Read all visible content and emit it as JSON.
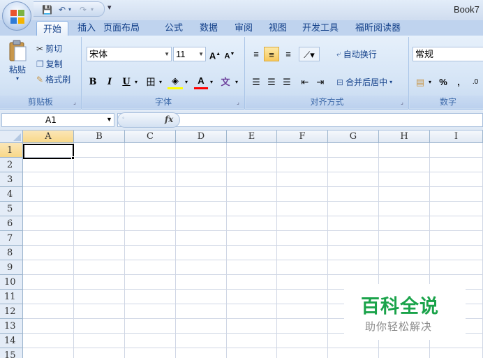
{
  "window": {
    "doc_title": "Book7"
  },
  "qat": {
    "save": "💾",
    "undo": "↶",
    "redo": "↷",
    "customize": "▾"
  },
  "tabs": [
    {
      "label": "开始"
    },
    {
      "label": "插入"
    },
    {
      "label": "页面布局"
    },
    {
      "label": "公式"
    },
    {
      "label": "数据"
    },
    {
      "label": "审阅"
    },
    {
      "label": "视图"
    },
    {
      "label": "开发工具"
    },
    {
      "label": "福昕阅读器"
    }
  ],
  "clipboard": {
    "paste": "粘贴",
    "cut": "剪切",
    "copy": "复制",
    "format_painter": "格式刷",
    "group_label": "剪贴板"
  },
  "font": {
    "name": "宋体",
    "size": "11",
    "grow": "A",
    "shrink": "A",
    "bold": "B",
    "italic": "I",
    "underline": "U",
    "border": "田",
    "fill": "◈",
    "color": "A",
    "phonetic": "文",
    "group_label": "字体"
  },
  "alignment": {
    "wrap": "自动换行",
    "merge": "合并后居中",
    "group_label": "对齐方式"
  },
  "number": {
    "format": "常规",
    "percent": "%",
    "comma": ",",
    "group_label": "数字"
  },
  "formula_bar": {
    "namebox": "A1",
    "fx": "fx"
  },
  "columns": [
    "A",
    "B",
    "C",
    "D",
    "E",
    "F",
    "G",
    "H",
    "I"
  ],
  "rows": [
    "1",
    "2",
    "3",
    "4",
    "5",
    "6",
    "7",
    "8",
    "9",
    "10",
    "11",
    "12",
    "13",
    "14",
    "15"
  ],
  "watermark": {
    "title": "百科全说",
    "subtitle": "助你轻松解决"
  },
  "colors": {
    "accent_selected": "#f8d889",
    "watermark_green": "#1aa34a",
    "ribbon": "#d6e5f6"
  }
}
